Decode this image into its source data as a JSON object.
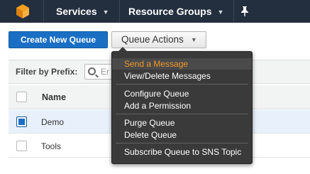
{
  "topnav": {
    "services": "Services",
    "resource_groups": "Resource Groups"
  },
  "toolbar": {
    "create_label": "Create New Queue",
    "actions_label": "Queue Actions"
  },
  "filter": {
    "label": "Filter by Prefix:",
    "placeholder": "Er"
  },
  "table": {
    "column_name": "Name",
    "rows": [
      {
        "name": "Demo",
        "checked": true
      },
      {
        "name": "Tools",
        "checked": false
      }
    ]
  },
  "menu": {
    "items": [
      "Send a Message",
      "View/Delete Messages",
      "Configure Queue",
      "Add a Permission",
      "Purge Queue",
      "Delete Queue",
      "Subscribe Queue to SNS Topic"
    ],
    "highlighted": "Send a Message"
  },
  "colors": {
    "nav_bg": "#232f3e",
    "primary": "#1a6fc4",
    "menu_bg": "#3a3a3a",
    "menu_highlight": "#f29a28"
  }
}
